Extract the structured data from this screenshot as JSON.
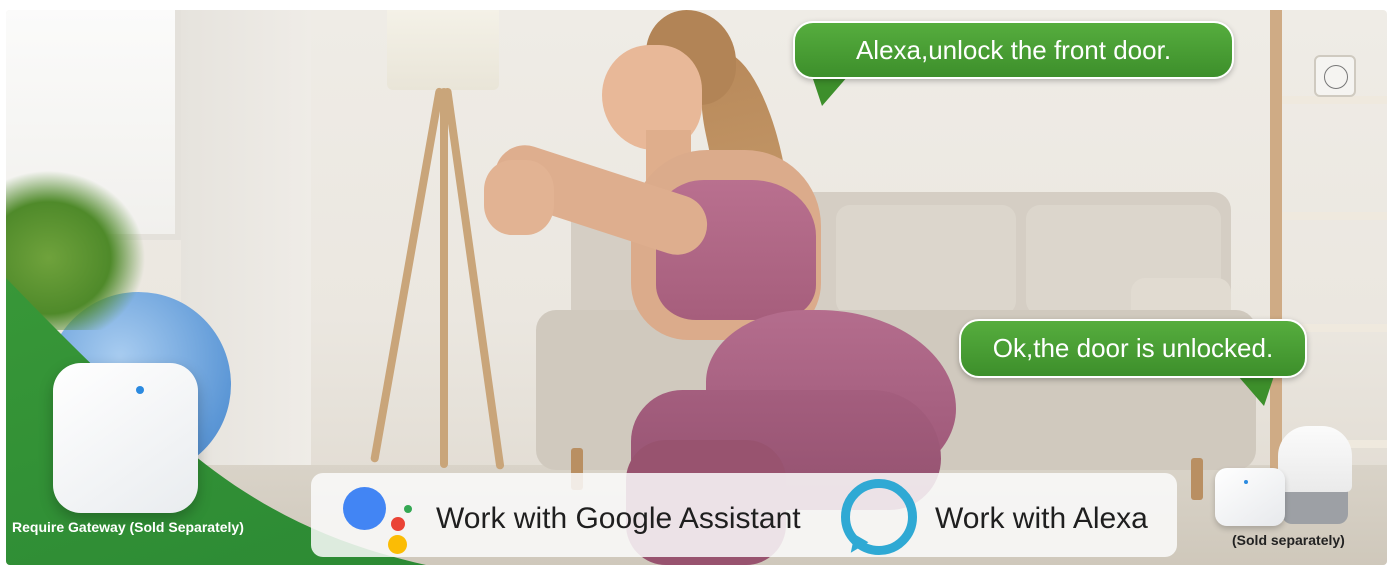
{
  "speech": {
    "command": "Alexa,unlock the front door.",
    "response": "Ok,the door is unlocked."
  },
  "compatibility": {
    "google_label": "Work with Google Assistant",
    "alexa_label": "Work with Alexa"
  },
  "captions": {
    "gateway": "Require Gateway (Sold Separately)",
    "smart_speaker": "(Sold separately)"
  },
  "colors": {
    "bubble_green": "#3d8f2b",
    "corner_green": "#2c8a34",
    "alexa_blue": "#2fa9d4",
    "google_blue": "#4285f4",
    "google_red": "#ea4335",
    "google_yellow": "#fbbc05",
    "google_green": "#34a853"
  },
  "icons": [
    "google-assistant-icon",
    "alexa-icon",
    "gateway-device",
    "smart-speaker-device"
  ]
}
